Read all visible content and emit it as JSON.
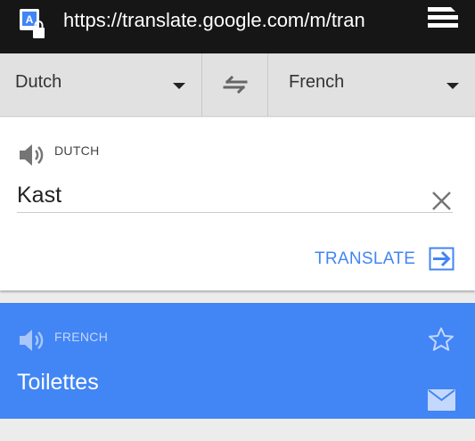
{
  "browser": {
    "url": "https://translate.google.com/m/tran"
  },
  "language_bar": {
    "source_language": "Dutch",
    "target_language": "French"
  },
  "source": {
    "language_caption": "DUTCH",
    "input_value": "Kast",
    "translate_label": "TRANSLATE"
  },
  "result": {
    "language_caption": "FRENCH",
    "text": "Toilettes"
  },
  "colors": {
    "accent_blue": "#4285f4",
    "url_bar": "#161616",
    "language_bar": "#e1e1e1"
  },
  "icons": [
    "google-translate-site-icon",
    "lock-icon",
    "menu-icon",
    "dropdown-icon",
    "swap-icon",
    "speaker-icon",
    "clear-icon",
    "arrow-right-icon",
    "star-icon",
    "mail-icon"
  ]
}
